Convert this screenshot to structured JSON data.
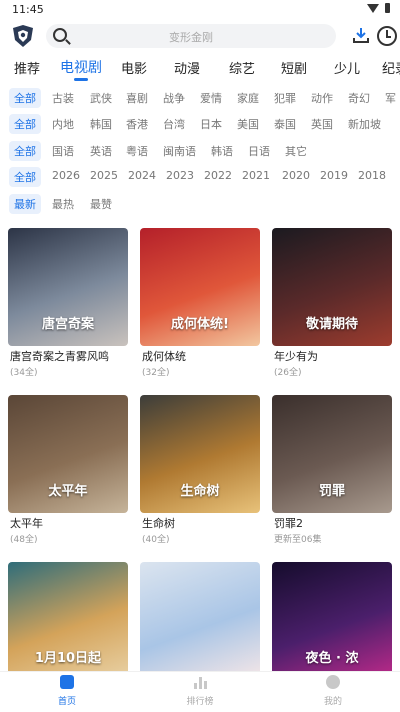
{
  "status": {
    "time": "11:45"
  },
  "search": {
    "placeholder": "变形金刚"
  },
  "tabs": [
    "推荐",
    "电视剧",
    "电影",
    "动漫",
    "综艺",
    "短剧",
    "少儿",
    "纪录"
  ],
  "active_tab": 1,
  "filters": {
    "genre": [
      "全部",
      "古装",
      "武侠",
      "喜剧",
      "战争",
      "爱情",
      "家庭",
      "犯罪",
      "动作",
      "奇幻",
      "军"
    ],
    "region": [
      "全部",
      "内地",
      "韩国",
      "香港",
      "台湾",
      "日本",
      "美国",
      "泰国",
      "英国",
      "新加坡"
    ],
    "language": [
      "全部",
      "国语",
      "英语",
      "粤语",
      "闽南语",
      "韩语",
      "日语",
      "其它"
    ],
    "year": [
      "全部",
      "2026",
      "2025",
      "2024",
      "2023",
      "2022",
      "2021",
      "2020",
      "2019",
      "2018"
    ],
    "sort": [
      "最新",
      "最热",
      "最赞"
    ]
  },
  "cards": [
    {
      "title": "唐宫奇案之青雾风鸣",
      "sub": "(34全)",
      "overlay": "唐宫奇案",
      "colors": [
        "#2c3446",
        "#7d8a9c",
        "#c9c2bd"
      ]
    },
    {
      "title": "成何体统",
      "sub": "(32全)",
      "overlay": "成何体统!",
      "colors": [
        "#b4202a",
        "#e0573a",
        "#f2c7a0"
      ]
    },
    {
      "title": "年少有为",
      "sub": "(26全)",
      "overlay": "敬请期待",
      "colors": [
        "#1b1a20",
        "#5b2a2a",
        "#9d3c2e"
      ]
    },
    {
      "title": "太平年",
      "sub": "(48全)",
      "overlay": "太平年",
      "colors": [
        "#5a4637",
        "#8a6f55",
        "#c6b49a"
      ]
    },
    {
      "title": "生命树",
      "sub": "(40全)",
      "overlay": "生命树",
      "colors": [
        "#3c3d3a",
        "#b07a32",
        "#e8c27a"
      ]
    },
    {
      "title": "罚罪2",
      "sub": "更新至06集",
      "overlay": "罚罪",
      "colors": [
        "#3a2f2c",
        "#6b5a52",
        "#a89a8e"
      ]
    },
    {
      "title": "",
      "sub": "",
      "overlay": "1月10日起",
      "colors": [
        "#2f6d7a",
        "#d4a35a",
        "#e9d2a6"
      ]
    },
    {
      "title": "",
      "sub": "",
      "overlay": "",
      "colors": [
        "#dbe4ef",
        "#a9c5e6",
        "#f6e7e7"
      ]
    },
    {
      "title": "",
      "sub": "",
      "overlay": "夜色 · 浓",
      "colors": [
        "#150c2c",
        "#4b1f6b",
        "#c02a8a"
      ]
    }
  ],
  "nav": [
    "首页",
    "排行榜",
    "我的"
  ]
}
